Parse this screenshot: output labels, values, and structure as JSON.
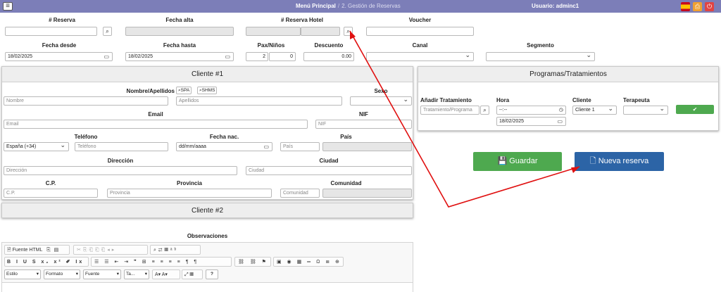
{
  "topbar": {
    "menu_icon": "hamburger-icon",
    "breadcrumb_main": "Menú Principal",
    "breadcrumb_sep": "/",
    "breadcrumb_current": "2. Gestión de Reservas",
    "user": "Usuario: adminc1",
    "icons": [
      "spain-flag-icon",
      "print-icon",
      "power-icon"
    ],
    "colors": {
      "bar": "#7c7eb8",
      "flag_red": "#c60b1e",
      "flag_yellow": "#ffc400",
      "print": "#f0a030",
      "power": "#e04444"
    }
  },
  "search": {
    "reserva_label": "# Reserva",
    "fecha_alta_label": "Fecha alta",
    "reserva_hotel_label": "# Reserva Hotel",
    "voucher_label": "Voucher",
    "fecha_desde_label": "Fecha desde",
    "fecha_desde_value": "18/02/2025",
    "fecha_hasta_label": "Fecha hasta",
    "fecha_hasta_value": "18/02/2025",
    "pax_label": "Pax/Niños",
    "pax_value": "2",
    "ninos_value": "0",
    "descuento_label": "Descuento",
    "descuento_value": "0.00",
    "canal_label": "Canal",
    "segmento_label": "Segmento"
  },
  "cliente1": {
    "title": "Cliente #1",
    "nombre_label": "Nombre/Apellidos",
    "spa_btn": "SPA",
    "shms_btn": "SHMS",
    "sexo_label": "Sexo",
    "nombre_ph": "Nombre",
    "apellidos_ph": "Apellidos",
    "email_label": "Email",
    "email_ph": "Email",
    "nif_label": "NIF",
    "nif_ph": "NIF",
    "telefono_label": "Teléfono",
    "pais_tel_value": "España (+34)",
    "telefono_ph": "Teléfono",
    "fecha_nac_label": "Fecha nac.",
    "fecha_nac_ph": "dd/mm/aaaa",
    "pais_label": "País",
    "pais_ph": "País",
    "direccion_label": "Dirección",
    "direccion_ph": "Dirección",
    "ciudad_label": "Ciudad",
    "ciudad_ph": "Ciudad",
    "cp_label": "C.P.",
    "cp_ph": "C.P.",
    "provincia_label": "Provincia",
    "provincia_ph": "Provincia",
    "comunidad_label": "Comunidad",
    "comunidad_ph": "Comunidad"
  },
  "cliente2": {
    "title": "Cliente #2"
  },
  "programas": {
    "title": "Programas/Tratamientos",
    "tratamiento_label": "Añadir Tratamiento",
    "tratamiento_ph": "Tratamiento/Programa",
    "hora_label": "Hora",
    "hora_ph": "--:--",
    "fecha_value": "18/02/2025",
    "cliente_label": "Cliente",
    "cliente_value": "Cliente 1",
    "terapeuta_label": "Terapeuta",
    "add_icon": "check-icon"
  },
  "actions": {
    "guardar": "Guardar",
    "nueva": "Nueva reserva",
    "colors": {
      "guardar": "#4ea94f",
      "nueva": "#2c64a6"
    }
  },
  "observaciones": {
    "title": "Observaciones",
    "fuente_html": "Fuente HTML",
    "estilo": "Estilo",
    "formato": "Formato",
    "fuente": "Fuente",
    "tamano": "Ta...",
    "help": "?"
  },
  "annotation": {
    "arrow_color": "#e01010"
  }
}
